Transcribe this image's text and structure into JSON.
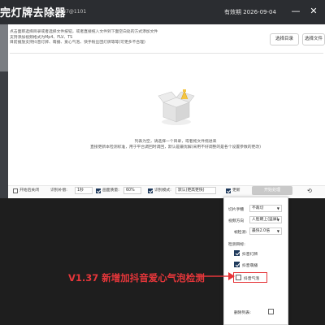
{
  "window": {
    "title": "完灯牌去除器",
    "version": "v1.37@1101",
    "expiry": "有效期 2026-09-04",
    "minimize_label": "—",
    "close_label": "✕"
  },
  "instructions": [
    "点击面即选择目录或者选择文件按钮，或者直接拖入文件到下面空白处的方式添加文件",
    "支持添加视频格式为Mp4、FLV、TS",
    "目前播放支持抖音灯牌、萌播、爱心气泡、快手粉丝团灯牌等等(可更多不合理)"
  ],
  "buttons": {
    "select_dir": "选择目录",
    "select_file": "选择文件"
  },
  "empty_state": {
    "line1": "列表为空，请选择一个目录，或者拖文件拖进来",
    "line2": "直接更新本检测标准，用于平台调回时调回，默认是最优解(采用不好调整的是各个设置参数的更改)"
  },
  "bottom_bar": {
    "cb1_label": "开始后关闭",
    "recog_label": "识别补偿:",
    "recog_value": "1秒",
    "quality_label": "画面质量:",
    "quality_value": "60%",
    "cb3_label": "识别模式:",
    "mode_value": "默认(更高更快)",
    "cb4_label": "更新",
    "start_label": "开始处理"
  },
  "panel": {
    "crop_label": "切片手糖",
    "crop_value": "不裁切",
    "video_dir_label": "视频方向",
    "video_dir_value": "人脸朝上(竖屏)",
    "quality_label": "帧检测:",
    "quality_value": "最快2.0倍",
    "detect_label": "检测目标:",
    "items": [
      {
        "label": "抖音灯牌",
        "checked": true
      },
      {
        "label": "抖音萌播",
        "checked": true
      },
      {
        "label": "抖音气泡",
        "checked": false
      }
    ],
    "delete_label": "删除列表:"
  },
  "annotation": "V1.37 新增加抖音爱心气泡检测",
  "colors": {
    "accent_red": "#e5363a",
    "checkbox_dark": "#1f3a5c",
    "titlebar": "#2b2d31"
  }
}
